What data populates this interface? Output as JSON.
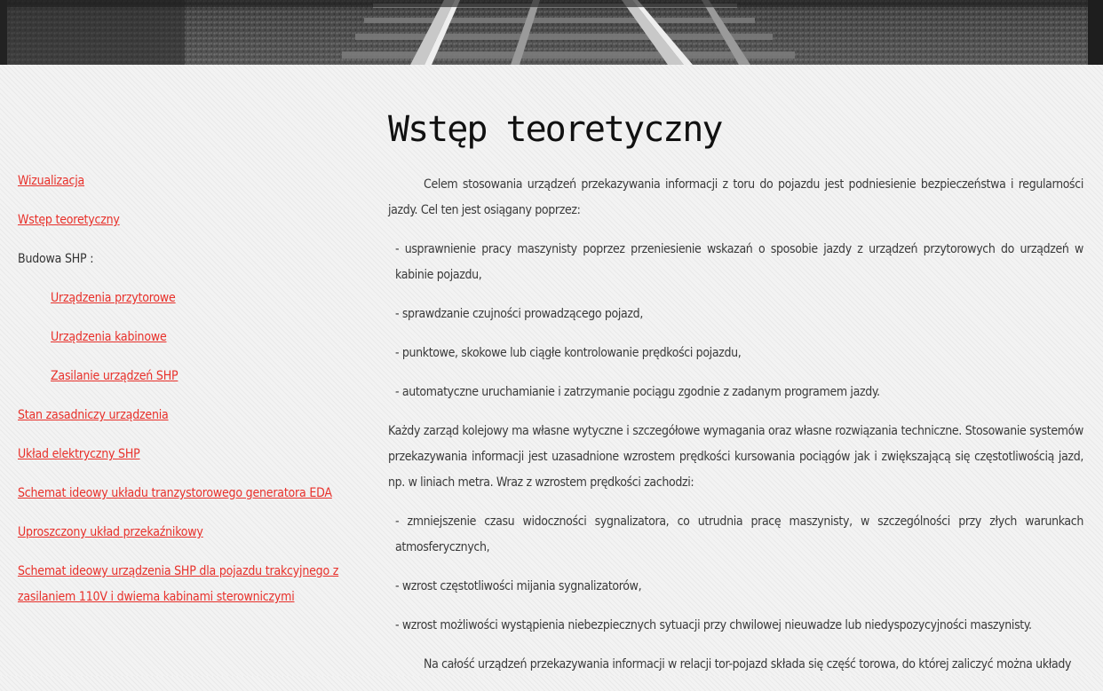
{
  "sidebar": {
    "items": [
      {
        "label": "Wizualizacja",
        "type": "link"
      },
      {
        "label": "Wstęp teoretyczny",
        "type": "link"
      },
      {
        "label": "Budowa SHP :",
        "type": "text"
      },
      {
        "label": "Urządzenia przytorowe",
        "type": "sublink"
      },
      {
        "label": "Urządzenia kabinowe",
        "type": "sublink"
      },
      {
        "label": "Zasilanie urządzeń SHP",
        "type": "sublink"
      },
      {
        "label": "Stan zasadniczy urządzenia",
        "type": "link"
      },
      {
        "label": "Układ elektryczny SHP",
        "type": "link"
      },
      {
        "label": "Schemat ideowy układu tranzystorowego generatora EDA",
        "type": "link"
      },
      {
        "label": "Uproszczony układ przekaźnikowy",
        "type": "link"
      },
      {
        "label": "Schemat ideowy urządzenia SHP dla pojazdu trakcyjnego z zasilaniem 110V i dwiema kabinami sterowniczymi",
        "type": "link"
      }
    ]
  },
  "content": {
    "title": "Wstęp teoretyczny",
    "paragraphs": [
      "Celem stosowania urządzeń przekazywania informacji z toru do pojazdu jest podniesienie bezpieczeństwa i regularności jazdy. Cel ten jest osiągany poprzez:",
      "- usprawnienie pracy maszynisty poprzez przeniesienie wskazań o sposobie jazdy z urządzeń przytorowych do urządzeń w kabinie pojazdu,",
      "- sprawdzanie czujności prowadzącego pojazd,",
      "- punktowe, skokowe lub ciągłe kontrolowanie prędkości pojazdu,",
      "- automatyczne uruchamianie i zatrzymanie pociągu zgodnie z zadanym programem jazdy.",
      "Każdy zarząd kolejowy ma własne wytyczne i szczegółowe wymagania oraz własne rozwiązania techniczne. Stosowanie systemów przekazywania informacji jest uzasadnione wzrostem prędkości kursowania pociągów jak i zwiększającą się częstotliwością jazd, np. w liniach metra. Wraz z wzrostem prędkości zachodzi:",
      "- zmniejszenie czasu widoczności sygnalizatora, co utrudnia pracę maszynisty, w szczególności przy złych warunkach atmosferycznych,",
      "- wzrost częstotliwości mijania sygnalizatorów,",
      "- wzrost możliwości wystąpienia niebezpiecznych sytuacji przy chwilowej nieuwadze lub niedyspozycyjności maszynisty.",
      "Na całość urządzeń przekazywania informacji w relacji tor-pojazd składa się część torowa, do której zaliczyć można układy"
    ]
  }
}
